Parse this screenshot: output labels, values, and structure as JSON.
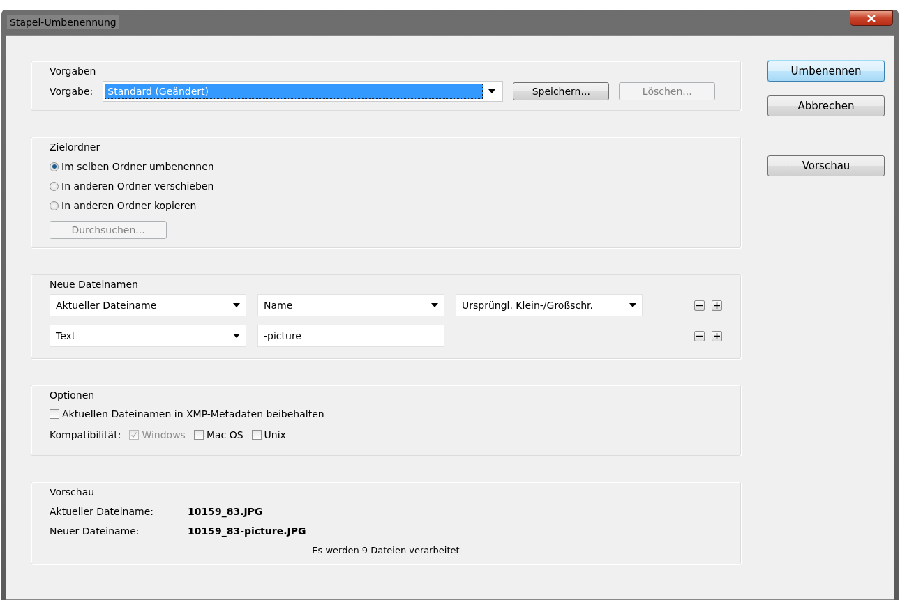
{
  "window": {
    "title": "Stapel-Umbenennung"
  },
  "presets": {
    "legend": "Vorgaben",
    "label": "Vorgabe:",
    "value": "Standard (Geändert)",
    "buttons": [
      {
        "label": "Speichern...",
        "disabled": false
      },
      {
        "label": "Löschen...",
        "disabled": true
      }
    ]
  },
  "target_folder": {
    "legend": "Zielordner",
    "options": [
      {
        "label": "Im selben Ordner umbenennen",
        "selected": true
      },
      {
        "label": "In anderen Ordner verschieben",
        "selected": false
      },
      {
        "label": "In anderen Ordner kopieren",
        "selected": false
      }
    ],
    "browse_button": {
      "label": "Durchsuchen...",
      "disabled": true
    }
  },
  "new_filenames": {
    "legend": "Neue Dateinamen",
    "rows": [
      {
        "fields": [
          {
            "kind": "dropdown",
            "value": "Aktueller Dateiname"
          },
          {
            "kind": "dropdown",
            "value": "Name"
          },
          {
            "kind": "dropdown",
            "value": "Ursprüngl. Klein-/Großschr."
          }
        ]
      },
      {
        "fields": [
          {
            "kind": "dropdown",
            "value": "Text"
          },
          {
            "kind": "text",
            "value": "-picture"
          }
        ]
      }
    ]
  },
  "options": {
    "legend": "Optionen",
    "keep_checkbox": {
      "label": "Aktuellen Dateinamen in XMP-Metadaten beibehalten",
      "checked": false
    },
    "compat_label": "Kompatibilität:",
    "compat": [
      {
        "label": "Windows",
        "checked": true,
        "disabled": true
      },
      {
        "label": "Mac OS",
        "checked": false,
        "disabled": false
      },
      {
        "label": "Unix",
        "checked": false,
        "disabled": false
      }
    ]
  },
  "preview": {
    "legend": "Vorschau",
    "rows": [
      {
        "label": "Aktueller Dateiname:",
        "value": "10159_83.JPG"
      },
      {
        "label": "Neuer Dateiname:",
        "value": "10159_83-picture.JPG"
      }
    ],
    "status": "Es werden 9 Dateien verarbeitet"
  },
  "side_buttons": [
    {
      "label": "Umbenennen",
      "default": true
    },
    {
      "label": "Abbrechen",
      "default": false
    },
    {
      "label": "Vorschau",
      "default": false
    }
  ]
}
